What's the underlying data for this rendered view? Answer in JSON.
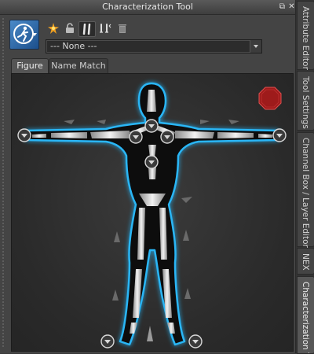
{
  "window": {
    "title": "Characterization Tool",
    "float_glyph": "⧉",
    "close_glyph": "✕"
  },
  "toolbar": {
    "logo_icon": "human-ik-logo-icon",
    "tools": [
      "create-character-icon",
      "lock-icon",
      "full-body-icon",
      "body-part-icon",
      "delete-icon"
    ]
  },
  "character_select": {
    "value": "--- None ---"
  },
  "tabs": [
    {
      "label": "Figure",
      "active": true
    },
    {
      "label": "Name Match",
      "active": false
    }
  ],
  "side_tabs": [
    {
      "label": "Attribute Editor",
      "active": false
    },
    {
      "label": "Tool Settings",
      "active": false
    },
    {
      "label": "Channel Box / Layer Editor",
      "active": false
    },
    {
      "label": "NEX",
      "active": false
    },
    {
      "label": "Characterization Too",
      "active": true
    }
  ],
  "colors": {
    "glow": "#29b6f6",
    "stop": "#9e1b1b",
    "bone": "#d9d9d9"
  }
}
